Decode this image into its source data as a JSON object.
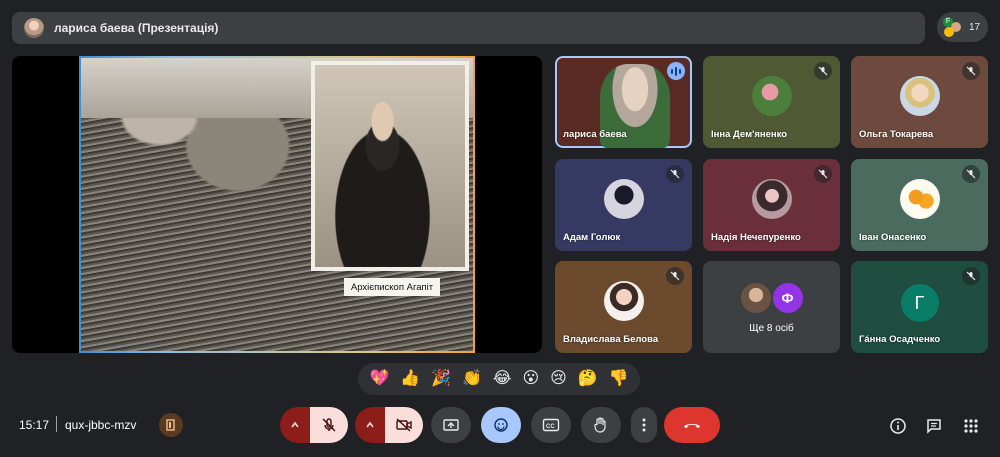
{
  "top": {
    "presenter_title": "лариса баева (Презентація)",
    "people_count": "17",
    "people_badge_letter": "F"
  },
  "presentation": {
    "caption": "Архієпископ Агапіт"
  },
  "participants": [
    {
      "name": "лариса баева",
      "state": "speaking",
      "bg": "#3a2e2a"
    },
    {
      "name": "Інна Дем'яненко",
      "state": "muted",
      "bg": "#4f5a34"
    },
    {
      "name": "Ольга Токарева",
      "state": "muted",
      "bg": "#6d4a3d"
    },
    {
      "name": "Адам Голюк",
      "state": "muted",
      "bg": "#363a63"
    },
    {
      "name": "Надія Нечепуренко",
      "state": "muted",
      "bg": "#6b2f3b"
    },
    {
      "name": "Іван Онасенко",
      "state": "muted",
      "bg": "#4a6b5e"
    },
    {
      "name": "Владислава Белова",
      "state": "muted",
      "bg": "#6b4a2e"
    },
    {
      "name": "Гáнна Осадченко",
      "state": "muted",
      "bg": "#1f4d3f",
      "letter": "Г"
    }
  ],
  "more": {
    "label": "Ще 8 осіб",
    "avatar_letter": "Ф"
  },
  "reactions": [
    "💖",
    "👍",
    "🎉",
    "👏",
    "😂",
    "😮",
    "😢",
    "🤔",
    "👎"
  ],
  "bottom": {
    "clock": "15:17",
    "meeting_code": "qux-jbbc-mzv"
  },
  "colors": {
    "background": "#202124",
    "mute_red": "#8c1d18",
    "mute_pink": "#f9dedc",
    "hangup": "#dc362e",
    "selected_blue": "#a8c7fa"
  },
  "icons": {
    "mic_off": "mic-off-icon",
    "cam_off": "videocam-off-icon",
    "present": "present-screen-icon",
    "emoji": "emoji-icon",
    "captions": "closed-captions-icon",
    "hand": "raise-hand-icon",
    "more": "more-vert-icon",
    "hangup": "call-end-icon",
    "info": "info-icon",
    "chat": "chat-icon",
    "activities": "apps-icon"
  }
}
